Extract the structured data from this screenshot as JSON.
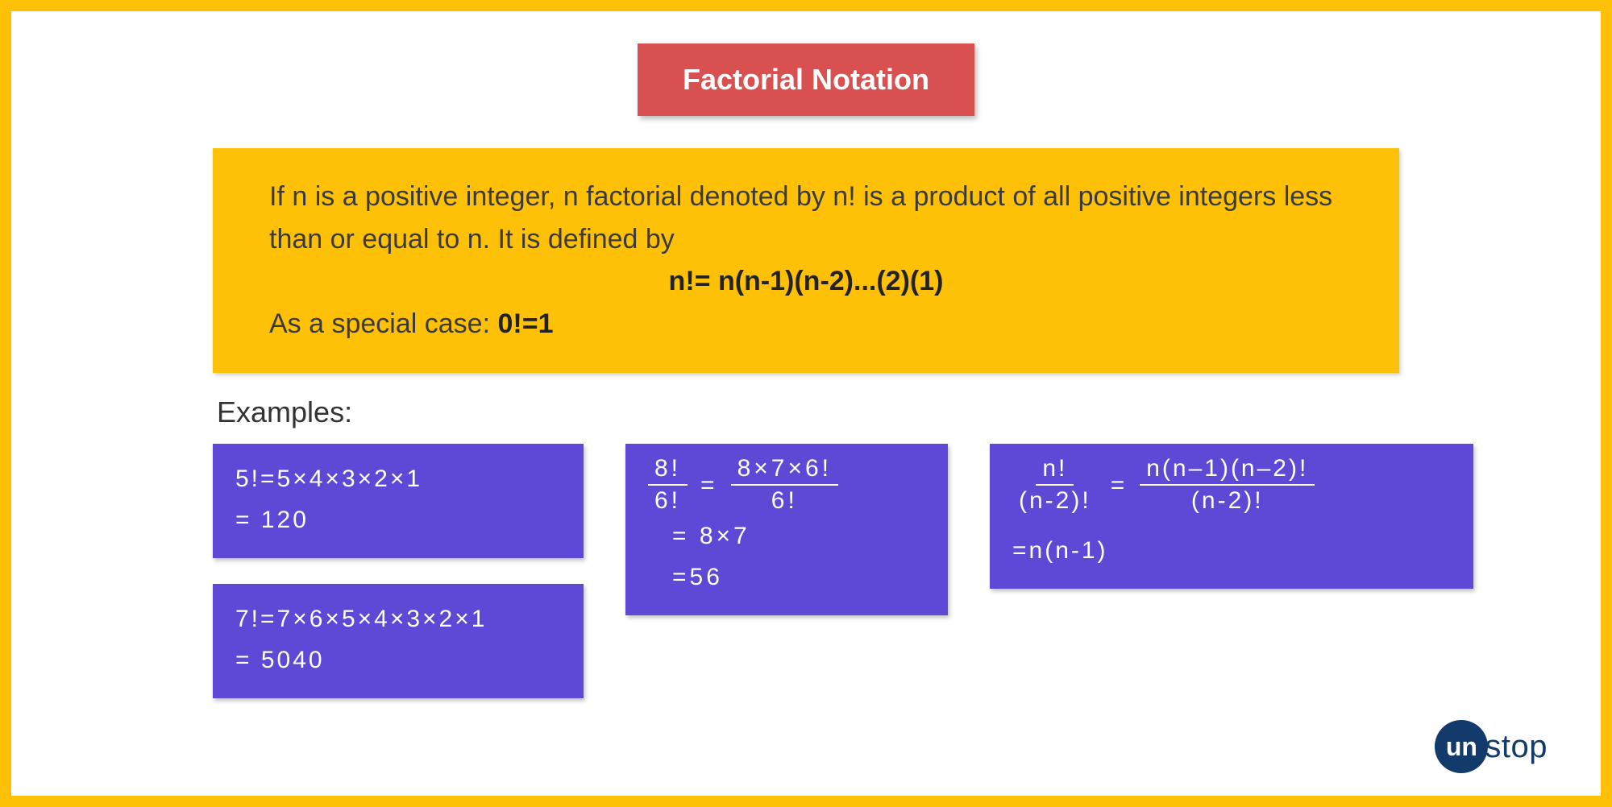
{
  "title": "Factorial Notation",
  "definition": {
    "line1": "If n is a positive integer, n factorial denoted by n! is a product of all positive integers less than or equal to n. It is defined by",
    "formula": "n!= n(n-1)(n-2)...(2)(1)",
    "special_prefix": "As a special case: ",
    "special_value": "0!=1"
  },
  "examples_label": "Examples:",
  "ex1": {
    "line1": "5!=5×4×3×2×1",
    "line2": "= 120"
  },
  "ex2": {
    "line1": "7!=7×6×5×4×3×2×1",
    "line2": "= 5040"
  },
  "ex3": {
    "lhs_top": "8!",
    "lhs_bot": "6!",
    "eq": "=",
    "rhs_top": "8×7×6!",
    "rhs_bot": "6!",
    "step1": "= 8×7",
    "step2": "=56"
  },
  "ex4": {
    "lhs_top": "n!",
    "lhs_bot": "(n-2)!",
    "eq": "=",
    "rhs_top": "n(n–1)(n–2)!",
    "rhs_bot": "(n-2)!",
    "step1": "=n(n-1)"
  },
  "logo": {
    "circle": "un",
    "rest": "stop"
  }
}
